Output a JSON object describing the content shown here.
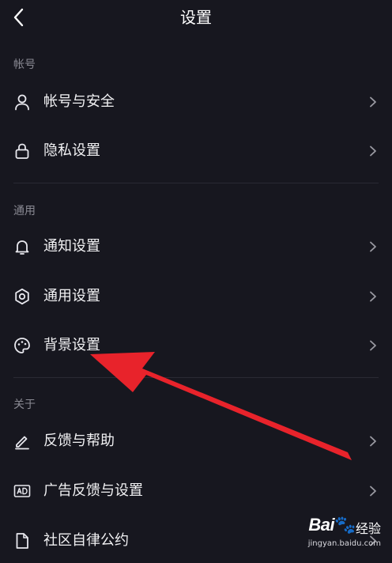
{
  "header": {
    "title": "设置",
    "back_icon": "chevron-left-icon"
  },
  "sections": [
    {
      "label": "帐号",
      "items": [
        {
          "label": "帐号与安全",
          "icon": "user-icon"
        },
        {
          "label": "隐私设置",
          "icon": "lock-icon"
        }
      ]
    },
    {
      "label": "通用",
      "items": [
        {
          "label": "通知设置",
          "icon": "bell-icon"
        },
        {
          "label": "通用设置",
          "icon": "gear-icon"
        },
        {
          "label": "背景设置",
          "icon": "palette-icon"
        }
      ]
    },
    {
      "label": "关于",
      "items": [
        {
          "label": "反馈与帮助",
          "icon": "pencil-icon"
        },
        {
          "label": "广告反馈与设置",
          "icon": "ad-icon"
        },
        {
          "label": "社区自律公约",
          "icon": "document-icon"
        }
      ]
    }
  ],
  "annotation": {
    "type": "red-arrow",
    "color": "#e8232b",
    "points_to": "背景设置"
  },
  "watermark": {
    "logo": "Bai",
    "logo_suffix": "经验",
    "url": "jingyan.baidu.com"
  },
  "colors": {
    "background": "#17171f",
    "text": "#f1f1f3",
    "section_label": "#8a8a93",
    "chevron": "#9a9aa2",
    "divider": "#2a2a33"
  }
}
